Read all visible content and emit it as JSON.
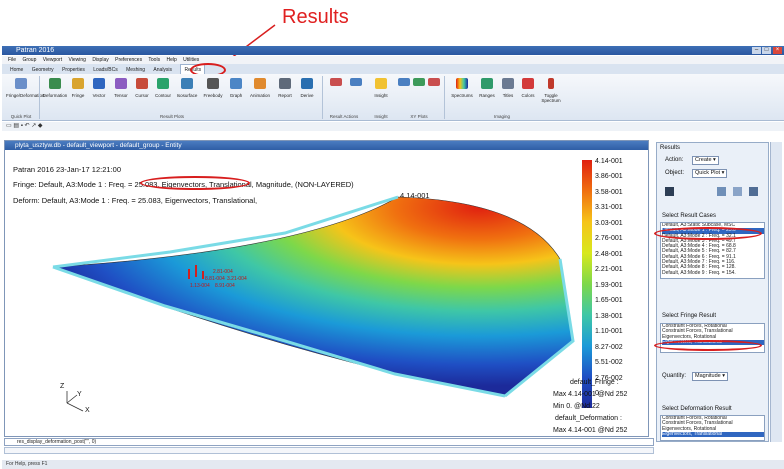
{
  "annotation": {
    "label": "Results"
  },
  "window": {
    "title": "Patran 2016"
  },
  "menu": [
    "File",
    "Group",
    "Viewport",
    "Viewing",
    "Display",
    "Preferences",
    "Tools",
    "Help",
    "Utilities"
  ],
  "tabs": [
    "Home",
    "Geometry",
    "Properties",
    "Loads/BCs",
    "Meshing",
    "Analysis",
    "Results"
  ],
  "ribbon": {
    "buttons": [
      "Fringe/Deformation",
      "Deformation",
      "Fringe",
      "Vector",
      "Tensor",
      "Cursor",
      "Contour",
      "Isosurface",
      "Freebody",
      "Graph",
      "Animation",
      "Report",
      "Derive",
      "",
      "",
      "Insight",
      "",
      "",
      "",
      "Spectrums",
      "Ranges",
      "Titles",
      "Colors",
      "Toggle Spectrum"
    ],
    "groups": [
      "Quick Plot",
      "Result Plots",
      "Result Actions",
      "Insight",
      "XY Plots",
      "Imaging"
    ]
  },
  "viewport": {
    "title": "plyta_usztyw.db - default_viewport - default_group - Entity",
    "line1": "Patran 2016 23-Jan-17 12:21:00",
    "line2": "Fringe: Default, A3:Mode 1 : Freq. = 25.083, Eigenvectors, Translational, Magnitude, (NON-LAYERED)",
    "line3": "Deform: Default, A3:Mode 1 : Freq. = 25.083, Eigenvectors, Translational,",
    "max_label": "4.14-001",
    "point_labels": [
      "2.81-004",
      "8.81-004",
      "3.21-004",
      "1.13-004",
      "8.91-004"
    ],
    "legend": [
      "4.14-001",
      "3.86-001",
      "3.58-001",
      "3.31-001",
      "3.03-001",
      "2.76-001",
      "2.48-001",
      "2.21-001",
      "1.93-001",
      "1.65-001",
      "1.38-001",
      "1.10-001",
      "8.27-002",
      "5.51-002",
      "2.76-002",
      "0."
    ],
    "legend_colors": [
      "#e02010",
      "#f07010",
      "#f6c419",
      "#d8e81c",
      "#7dd84a",
      "#3fc7a6",
      "#1b9ad8",
      "#1f4fc4",
      "#1c2a9a"
    ],
    "summary": [
      "default_Fringe :",
      "Max 4.14-001 @Nd 252",
      "Min 0. @Nd 22",
      "default_Deformation :",
      "Max 4.14-001 @Nd 252"
    ],
    "axis": {
      "z": "Z",
      "y": "Y",
      "x": "X"
    }
  },
  "panel": {
    "header": "Results",
    "action_label": "Action:",
    "action_value": "Create",
    "object_label": "Object:",
    "object_value": "Quick Plot",
    "cases_title": "Select Result Cases",
    "cases": [
      "Default, A3:Static Subcase, MSC",
      "Default, A3:Mode 1 : Freq. = 25.0",
      "Default, A3:Mode 2 : Freq. = 32.1",
      "Default, A3:Mode 3 : Freq. = 49.7",
      "Default, A3:Mode 4 : Freq. = 68.8",
      "Default, A3:Mode 5 : Freq. = 82.7",
      "Default, A3:Mode 6 : Freq. = 91.1",
      "Default, A3:Mode 7 : Freq. = 116.",
      "Default, A3:Mode 8 : Freq. = 128.",
      "Default, A3:Mode 9 : Freq. = 154."
    ],
    "fringe_title": "Select Fringe Result",
    "fringe": [
      "Constraint Forces, Rotational",
      "Constraint Forces, Translational",
      "Eigenvectors, Rotational",
      "Eigenvectors, Translational"
    ],
    "quantity_label": "Quantity:",
    "quantity_value": "Magnitude",
    "deform_title": "Select Deformation Result",
    "deform": [
      "Constraint Forces, Rotational",
      "Constraint Forces, Translational",
      "Eigenvectors, Rotational",
      "Eigenvectors, Translational"
    ]
  },
  "command": "res_display_deformation_post(\"\", 0)",
  "status": "For Help, press F1"
}
